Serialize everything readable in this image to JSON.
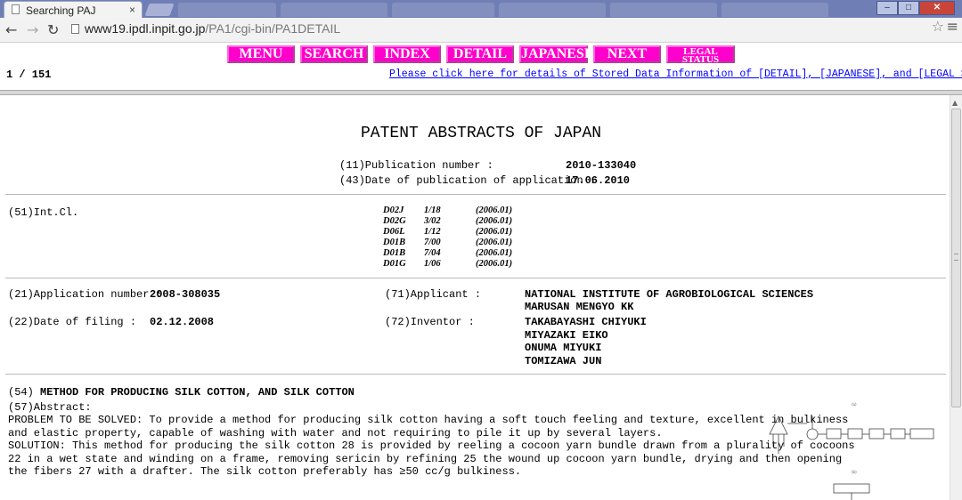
{
  "browser": {
    "tab_title": "Searching PAJ",
    "tab_close": "×",
    "url_host": "www19.ipdl.inpit.go.jp",
    "url_path": "/PA1/cgi-bin/PA1DETAIL"
  },
  "toolbar": {
    "menu": "MENU",
    "search": "SEARCH",
    "index": "INDEX",
    "detail": "DETAIL",
    "japanese": "JAPANESE",
    "next": "NEXT",
    "legal_line1": "LEGAL",
    "legal_line2": "STATUS"
  },
  "nav": {
    "counter": "1 / 151",
    "stored_link": "Please click here for details of Stored Data Information of [DETAIL], [JAPANESE], and [LEGAL STATUS]."
  },
  "doc": {
    "title": "PATENT ABSTRACTS OF JAPAN",
    "pub_no_label": "(11)Publication number :",
    "pub_no": "2010-133040",
    "pub_date_label": "(43)Date of publication of application :",
    "pub_date": "17.06.2010",
    "intcl_label": "(51)Int.Cl.",
    "intcl": [
      {
        "code": "D02J",
        "group": "1/18",
        "ver": "(2006.01)"
      },
      {
        "code": "D02G",
        "group": "3/02",
        "ver": "(2006.01)"
      },
      {
        "code": "D06L",
        "group": "1/12",
        "ver": "(2006.01)"
      },
      {
        "code": "D01B",
        "group": "7/00",
        "ver": "(2006.01)"
      },
      {
        "code": "D01B",
        "group": "7/04",
        "ver": "(2006.01)"
      },
      {
        "code": "D01G",
        "group": "1/06",
        "ver": "(2006.01)"
      }
    ],
    "app_no_label": "(21)Application number :",
    "app_no": "2008-308035",
    "filing_label": "(22)Date of filing :",
    "filing_date": "02.12.2008",
    "applicant_label": "(71)Applicant :",
    "applicants": [
      "NATIONAL INSTITUTE OF AGROBIOLOGICAL SCIENCES",
      "MARUSAN MENGYO KK"
    ],
    "inventor_label": "(72)Inventor :",
    "inventors": [
      "TAKABAYASHI CHIYUKI",
      "MIYAZAKI EIKO",
      "ONUMA MIYUKI",
      "TOMIZAWA JUN"
    ],
    "title_prefix": "(54)",
    "invention_title": "METHOD FOR PRODUCING SILK COTTON, AND SILK COTTON",
    "abstract_label": "(57)Abstract:",
    "abstract_lines": [
      "PROBLEM TO BE SOLVED: To provide a method for producing silk cotton having a soft touch feeling and texture, excellent in bulkiness",
      "and elastic property, capable of washing with water and not requiring to pile it up by several layers.",
      "SOLUTION: This method for producing the silk cotton 28 is provided by reeling a cocoon yarn bundle drawn from a plurality of cocoons",
      "22 in a wet state and winding on a frame, removing sericin by refining 25 the wound up cocoon yarn bundle, drying and then opening",
      "the fibers 27 with a drafter. The silk cotton preferably has ≥50 cc/g bulkiness."
    ]
  },
  "colors": {
    "nav_button": "#ff00cc",
    "link": "#0000ff",
    "titlebar": "#6f7fb6"
  }
}
